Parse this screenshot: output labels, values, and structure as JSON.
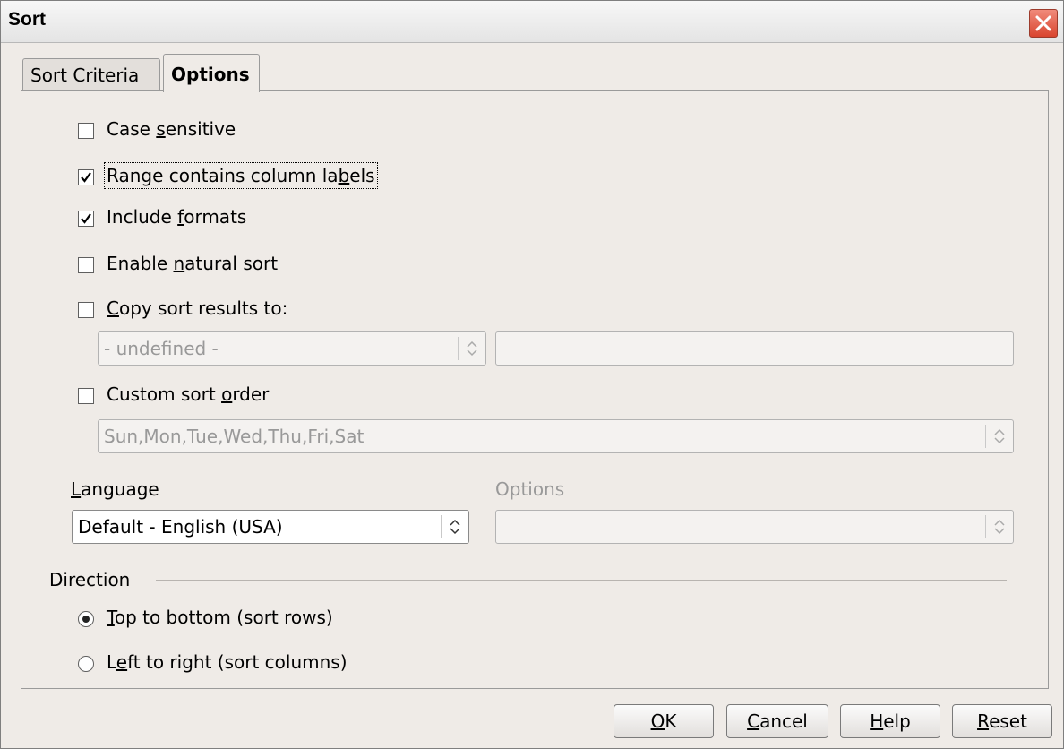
{
  "window": {
    "title": "Sort"
  },
  "tabs": [
    {
      "label": "Sort Criteria"
    },
    {
      "label": "Options"
    }
  ],
  "options": {
    "case_sensitive": {
      "pre": "Case ",
      "key": "s",
      "post": "ensitive",
      "checked": false
    },
    "column_labels": {
      "pre": "Range contains column la",
      "key": "b",
      "post": "els",
      "checked": true
    },
    "include_formats": {
      "pre": "Include ",
      "key": "f",
      "post": "ormats",
      "checked": true
    },
    "natural_sort": {
      "pre": "Enable ",
      "key": "n",
      "post": "atural sort",
      "checked": false
    },
    "copy_results": {
      "pre": "",
      "key": "C",
      "post": "opy sort results to:",
      "checked": false
    },
    "copy_target_value": "- undefined -",
    "custom_order": {
      "pre": "Custom sort ",
      "key": "o",
      "post": "rder",
      "checked": false
    },
    "custom_order_value": "Sun,Mon,Tue,Wed,Thu,Fri,Sat"
  },
  "language": {
    "label_key": "L",
    "label_rest": "anguage",
    "value": "Default - English (USA)",
    "options_label": "Options",
    "options_value": ""
  },
  "direction": {
    "legend": "Direction",
    "top_to_bottom": {
      "pre": "",
      "key": "T",
      "post": "op to bottom (sort rows)",
      "selected": true
    },
    "left_to_right": {
      "pre": "L",
      "key": "e",
      "post": "ft to right (sort columns)",
      "selected": false
    }
  },
  "buttons": {
    "ok": {
      "key": "O",
      "rest": "K"
    },
    "cancel": {
      "key": "C",
      "rest": "ancel"
    },
    "help": {
      "key": "H",
      "rest": "elp"
    },
    "reset": {
      "key": "R",
      "rest": "eset"
    }
  },
  "colors": {
    "dialog_bg": "#efebe7",
    "close_red": "#d9452f",
    "disabled_text": "#999999"
  },
  "icons": [
    "close-icon",
    "checkmark-icon",
    "spin-arrows-icon",
    "radio-dot-icon"
  ]
}
